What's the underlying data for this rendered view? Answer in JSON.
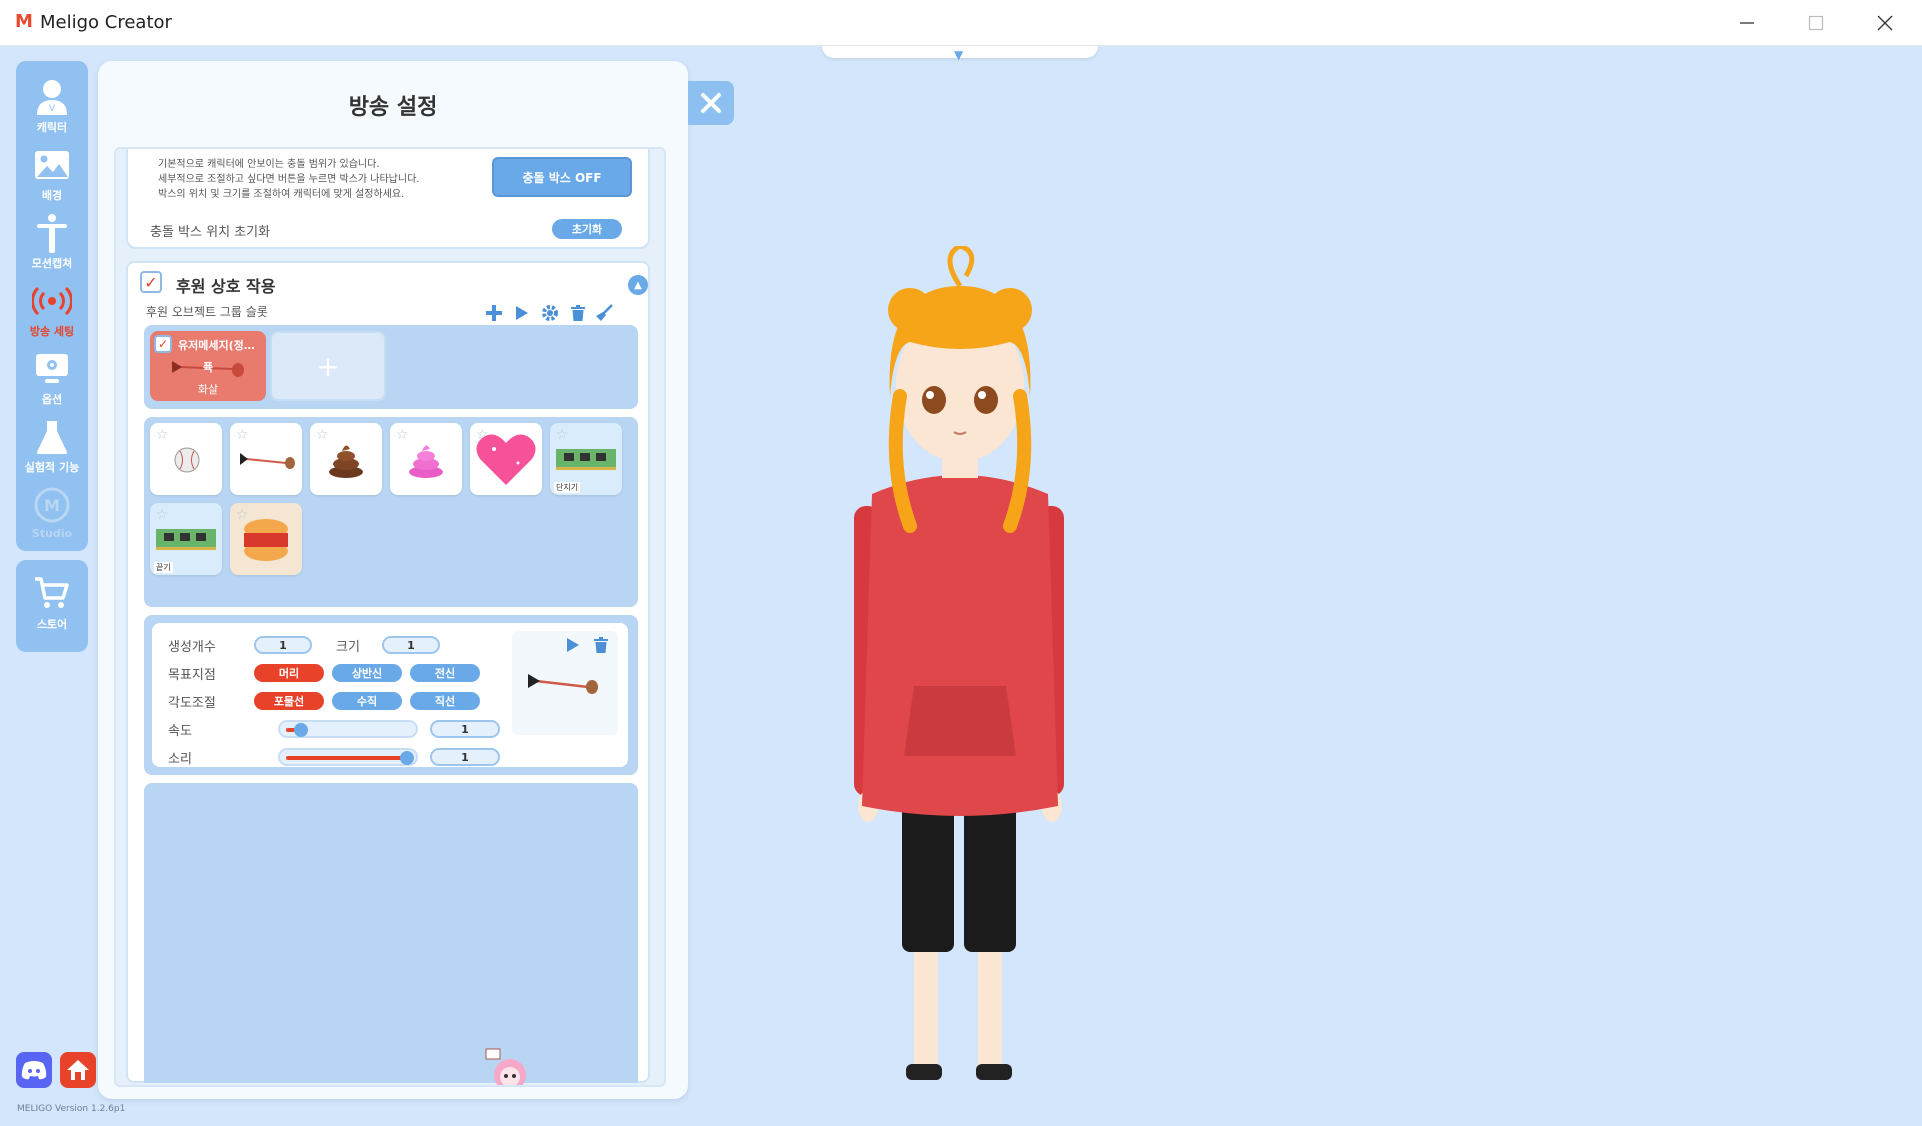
{
  "window": {
    "app_logo": "M",
    "title": "Meligo Creator",
    "minimize": "—",
    "maximize": "☐",
    "close": "✕"
  },
  "sidebar": {
    "items": [
      {
        "label": "캐릭터",
        "icon": "character-icon"
      },
      {
        "label": "배경",
        "icon": "image-icon"
      },
      {
        "label": "모션캡쳐",
        "icon": "motion-capture-icon"
      },
      {
        "label": "방송 세팅",
        "icon": "broadcast-icon"
      },
      {
        "label": "옵션",
        "icon": "settings-monitor-icon"
      },
      {
        "label": "실험적 기능",
        "icon": "flask-icon"
      },
      {
        "label": "Studio",
        "icon": "studio-logo-icon"
      }
    ],
    "store_label": "스토어"
  },
  "version": "MELIGO Version 1.2.6p1",
  "panel": {
    "title": "방송 설정",
    "collision": {
      "desc_lines": [
        "기본적으로 캐릭터에 안보이는 충돌 범위가 있습니다.",
        "세부적으로 조절하고 싶다면 버튼을 누르면 박스가 나타납니다.",
        "박스의 위치 및 크기를 조절하여 캐릭터에 맞게 설정하세요."
      ],
      "toggle_button": "충돌 박스 OFF",
      "reset_label": "충돌 박스 위치 초기화",
      "reset_button": "초기화"
    },
    "donation": {
      "title": "후원 상호 작용",
      "checked_mark": "✓",
      "group_label": "후원 오브젝트 그룹 슬롯",
      "slot_name": "유저메세지(정…",
      "slot_sub": "퓩",
      "slot_type": "화살",
      "add_slot": "+",
      "tile_tags": [
        "단지기",
        "끝기"
      ],
      "settings": {
        "count_label": "생성개수",
        "count_value": "1",
        "size_label": "크기",
        "size_value": "1",
        "target_label": "목표지점",
        "target_options": [
          "머리",
          "상반신",
          "전신"
        ],
        "angle_label": "각도조절",
        "angle_options": [
          "포물선",
          "수직",
          "직선"
        ],
        "speed_label": "속도",
        "speed_value": "1",
        "speed_level": 0.1,
        "sound_label": "소리",
        "sound_value": "1",
        "sound_level": 1.0
      }
    }
  },
  "colors": {
    "accent": "#6aa9e8",
    "active": "#e8432a",
    "background": "#d4e6fb"
  }
}
